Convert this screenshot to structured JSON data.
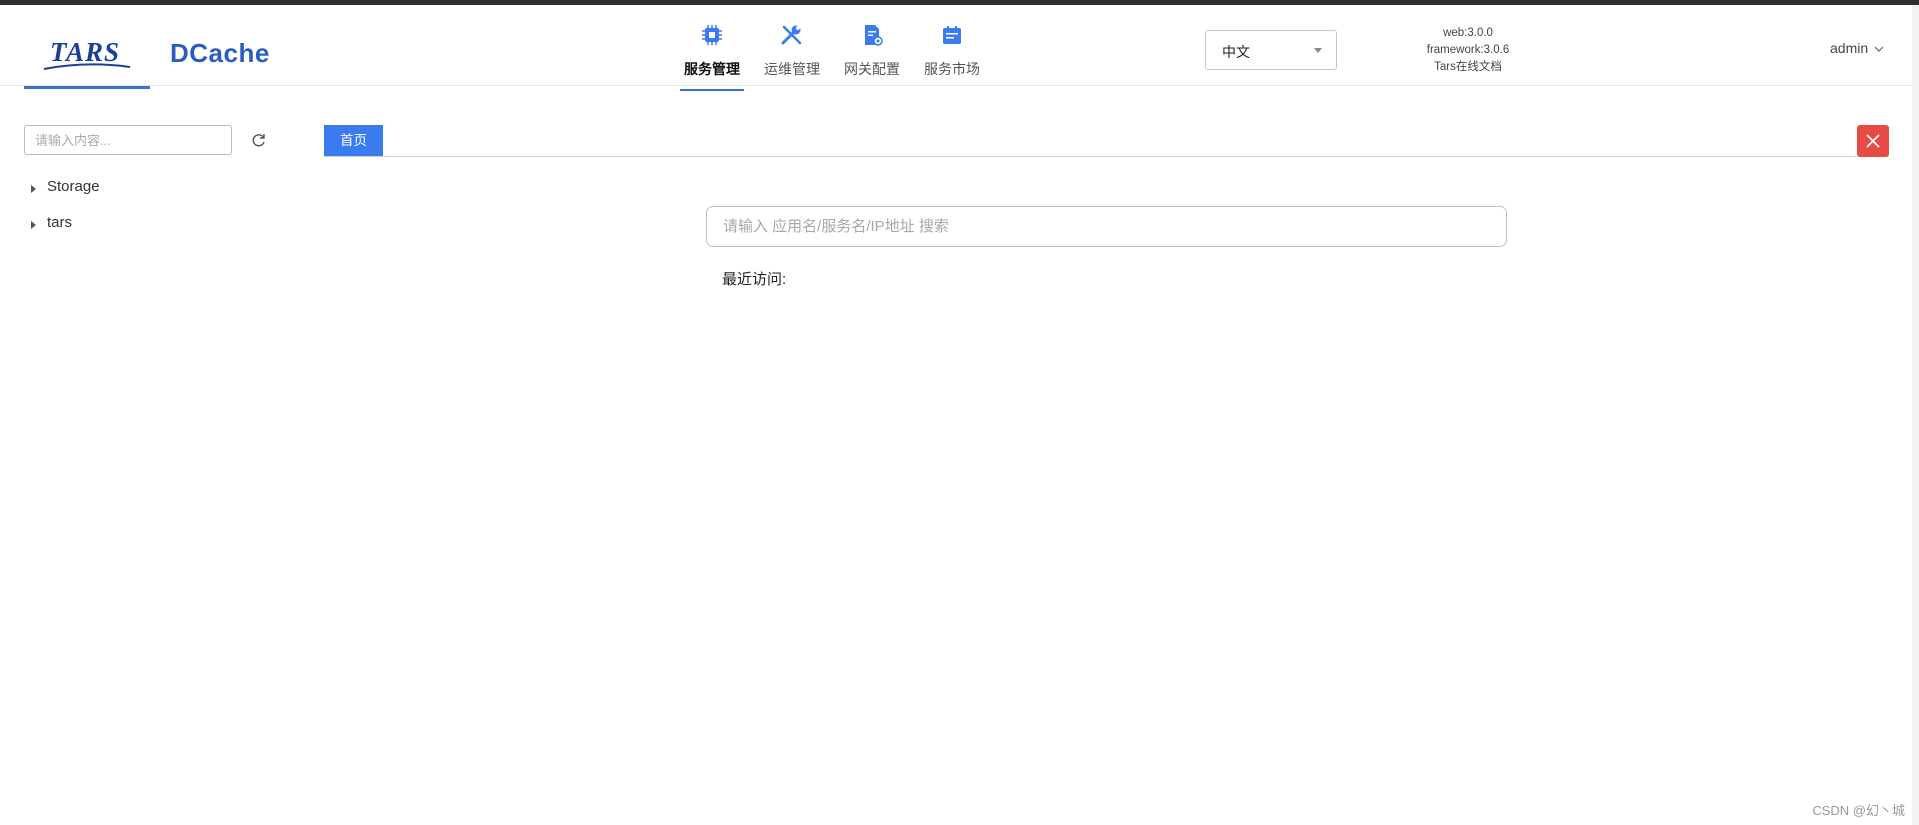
{
  "header": {
    "logo_tars": "TARS",
    "logo_dcache": "DCache",
    "nav": [
      {
        "label": "服务管理",
        "icon": "chip-icon",
        "active": true
      },
      {
        "label": "运维管理",
        "icon": "wrench-icon",
        "active": false
      },
      {
        "label": "网关配置",
        "icon": "gateway-icon",
        "active": false
      },
      {
        "label": "服务市场",
        "icon": "market-icon",
        "active": false
      }
    ],
    "language": {
      "selected": "中文"
    },
    "version": {
      "web": "web:3.0.0",
      "framework": "framework:3.0.6",
      "docs": "Tars在线文档"
    },
    "user": "admin"
  },
  "sidebar": {
    "search_placeholder": "请输入内容...",
    "tree": [
      {
        "label": "Storage"
      },
      {
        "label": "tars"
      }
    ]
  },
  "tabs": [
    {
      "label": "首页",
      "active": true
    }
  ],
  "main": {
    "search_placeholder": "请输入 应用名/服务名/IP地址 搜索",
    "recent_label": "最近访问:"
  },
  "watermark": "CSDN @幻丶城",
  "colors": {
    "accent": "#3a7bf0",
    "close": "#e84a45",
    "brand": "#1a3e9b"
  }
}
